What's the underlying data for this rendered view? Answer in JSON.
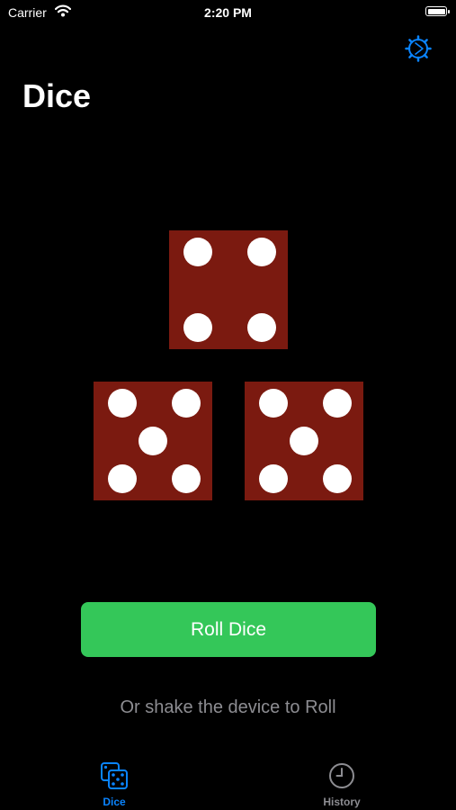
{
  "status_bar": {
    "carrier": "Carrier",
    "time": "2:20 PM"
  },
  "header": {
    "title": "Dice"
  },
  "dice": [
    {
      "value": 4
    },
    {
      "value": 5
    },
    {
      "value": 5
    }
  ],
  "actions": {
    "roll_label": "Roll Dice",
    "hint": "Or shake the device to Roll"
  },
  "tab_bar": {
    "tabs": [
      {
        "label": "Dice",
        "icon": "dice-icon",
        "selected": true
      },
      {
        "label": "History",
        "icon": "clock-icon",
        "selected": false
      }
    ]
  },
  "colors": {
    "accent": "#0a84ff",
    "die_face": "#7b1a10",
    "roll_button": "#34c759",
    "hint_text": "#8d8d92",
    "inactive_tab": "#8d8d92"
  }
}
